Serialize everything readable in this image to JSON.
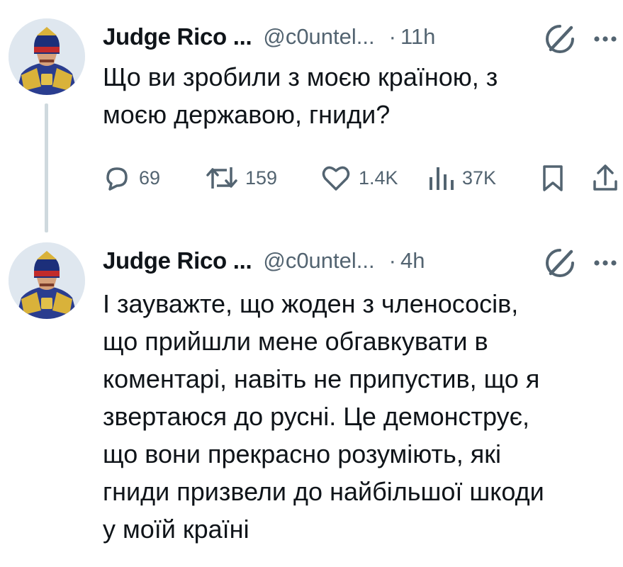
{
  "tweets": [
    {
      "display_name": "Judge Rico ...",
      "handle": "@c0untel...",
      "separator": "·",
      "time": "11h",
      "text": "Що ви зробили з моєю країною, з\nмоєю державою, гниди?",
      "stats": {
        "replies": "69",
        "retweets": "159",
        "likes": "1.4K",
        "views": "37K"
      }
    },
    {
      "display_name": "Judge Rico ...",
      "handle": "@c0untel...",
      "separator": "·",
      "time": "4h",
      "text": "І зауважте, що жоден з членососів,\nщо прийшли мене обгавкувати в\nкоментарі, навіть не припустив, що я\nзвертаюся до русні. Це демонструє,\nщо вони прекрасно розуміють, які\nгниди призвели до найбільшої шкоди\nу моїй країні"
    }
  ],
  "icons": {
    "reply": "reply-icon",
    "retweet": "retweet-icon",
    "like": "heart-icon",
    "views": "views-chart-icon",
    "bookmark": "bookmark-icon",
    "share": "share-icon",
    "grok": "grok-icon",
    "more": "more-icon"
  },
  "colors": {
    "text_primary": "#0f1419",
    "text_secondary": "#536471",
    "thread_line": "#cfd9de"
  }
}
